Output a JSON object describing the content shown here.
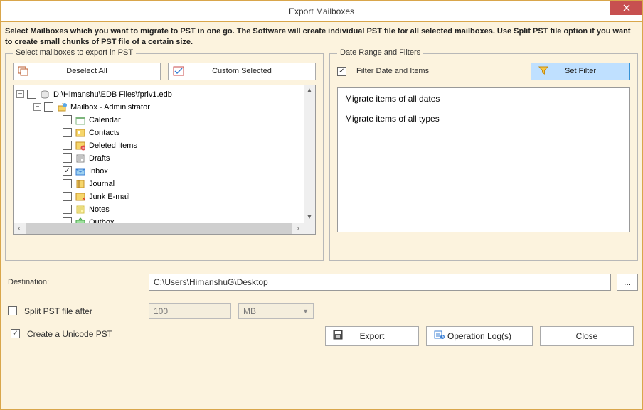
{
  "window_title": "Export Mailboxes",
  "intro_text": "Select Mailboxes which you want to migrate to PST in one go. The Software will create individual PST file for all selected mailboxes. Use Split PST file option if you want to create small chunks of PST file of a certain size.",
  "left_group_label": "Select mailboxes to export in PST",
  "right_group_label": "Date Range and Filters",
  "deselect_all_label": "Deselect All",
  "custom_selected_label": "Custom Selected",
  "filter_checkbox_label": "Filter Date and Items",
  "filter_checkbox_checked": true,
  "set_filter_label": "Set Filter",
  "filter_text_line1": "Migrate items of all dates",
  "filter_text_line2": "Migrate items of all types",
  "destination_label": "Destination:",
  "destination_value": "C:\\Users\\HimanshuG\\Desktop",
  "split_label": "Split PST file after",
  "split_checked": false,
  "split_value": "100",
  "split_unit": "MB",
  "unicode_label": "Create a Unicode PST",
  "unicode_checked": true,
  "export_label": "Export",
  "logs_label": "Operation Log(s)",
  "close_label": "Close",
  "tree": {
    "root": {
      "label": "D:\\Himanshu\\EDB Files\\fpriv1.edb",
      "expanded": true,
      "checked": false
    },
    "mailbox": {
      "label": "Mailbox - Administrator",
      "expanded": true,
      "checked": false
    },
    "folders": [
      {
        "label": "Calendar",
        "checked": false,
        "icon": "calendar"
      },
      {
        "label": "Contacts",
        "checked": false,
        "icon": "contacts"
      },
      {
        "label": "Deleted Items",
        "checked": false,
        "icon": "deleted"
      },
      {
        "label": "Drafts",
        "checked": false,
        "icon": "drafts"
      },
      {
        "label": "Inbox",
        "checked": true,
        "icon": "inbox"
      },
      {
        "label": "Journal",
        "checked": false,
        "icon": "journal"
      },
      {
        "label": "Junk E-mail",
        "checked": false,
        "icon": "junk"
      },
      {
        "label": "Notes",
        "checked": false,
        "icon": "notes"
      },
      {
        "label": "Outbox",
        "checked": false,
        "icon": "outbox"
      }
    ]
  }
}
